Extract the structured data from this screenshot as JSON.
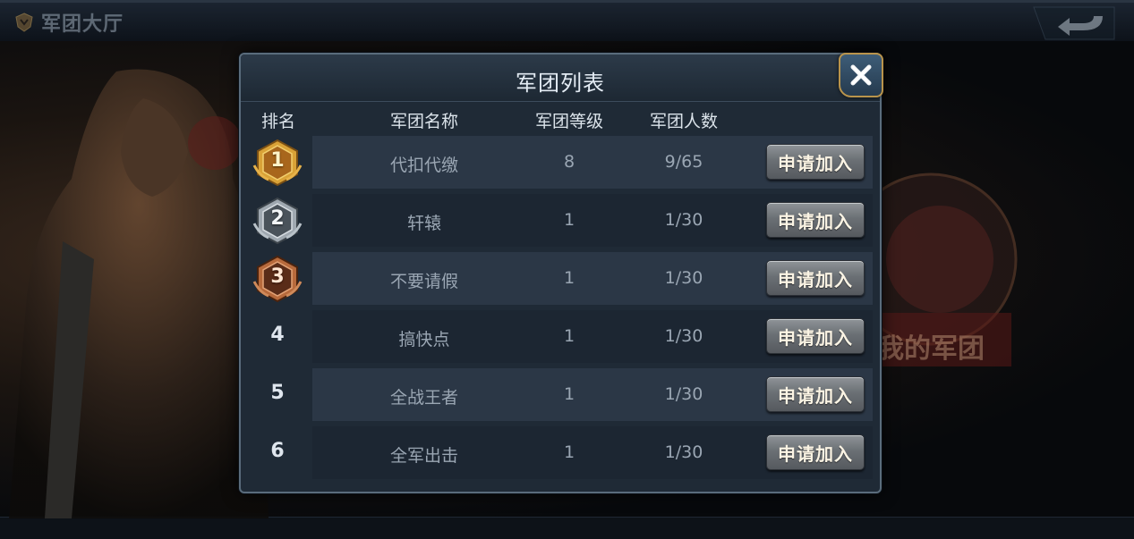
{
  "hall": {
    "title": "军团大厅",
    "icon": "legion-emblem-icon",
    "back_icon": "back-arrow-icon",
    "right_panel_label": "我的军团"
  },
  "dialog": {
    "title": "军团列表",
    "close_icon": "close-icon",
    "columns": {
      "rank": "排名",
      "name": "军团名称",
      "level": "军团等级",
      "members": "军团人数"
    },
    "rows": [
      {
        "rank": "1",
        "badge": "gold",
        "name": "代扣代缴",
        "level": "8",
        "members": "9/65",
        "action": "申请加入"
      },
      {
        "rank": "2",
        "badge": "silver",
        "name": "轩辕",
        "level": "1",
        "members": "1/30",
        "action": "申请加入"
      },
      {
        "rank": "3",
        "badge": "bronze",
        "name": "不要请假",
        "level": "1",
        "members": "1/30",
        "action": "申请加入"
      },
      {
        "rank": "4",
        "badge": "",
        "name": "搞快点",
        "level": "1",
        "members": "1/30",
        "action": "申请加入"
      },
      {
        "rank": "5",
        "badge": "",
        "name": "全战王者",
        "level": "1",
        "members": "1/30",
        "action": "申请加入"
      },
      {
        "rank": "6",
        "badge": "",
        "name": "全军出击",
        "level": "1",
        "members": "1/30",
        "action": "申请加入"
      }
    ]
  },
  "colors": {
    "gold": "#d9a237",
    "silver": "#9fa8b0",
    "bronze": "#b76a3c",
    "panel": "#1f2a36",
    "button": "#6b7075"
  }
}
